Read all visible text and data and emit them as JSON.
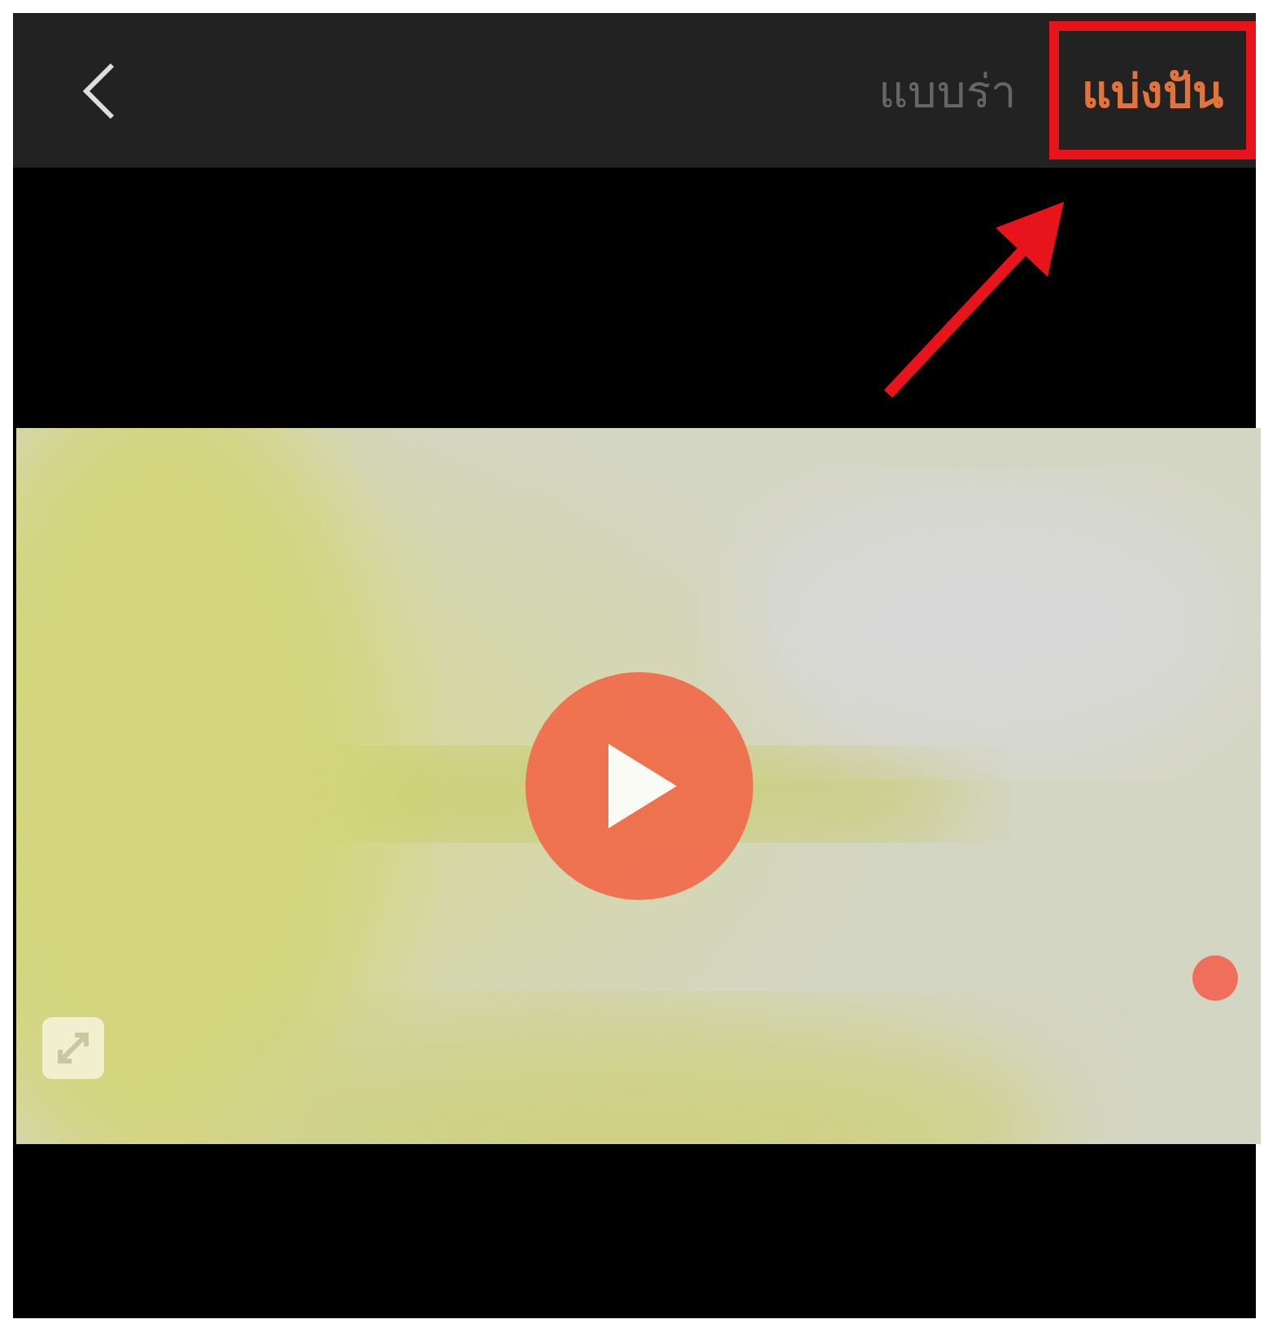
{
  "header": {
    "tabs": [
      {
        "label": "แบบร่า",
        "selected": false,
        "boxed": false
      },
      {
        "label": "แบ่งปัน",
        "selected": true,
        "boxed": true
      }
    ]
  },
  "annotation": {
    "arrow": true
  }
}
